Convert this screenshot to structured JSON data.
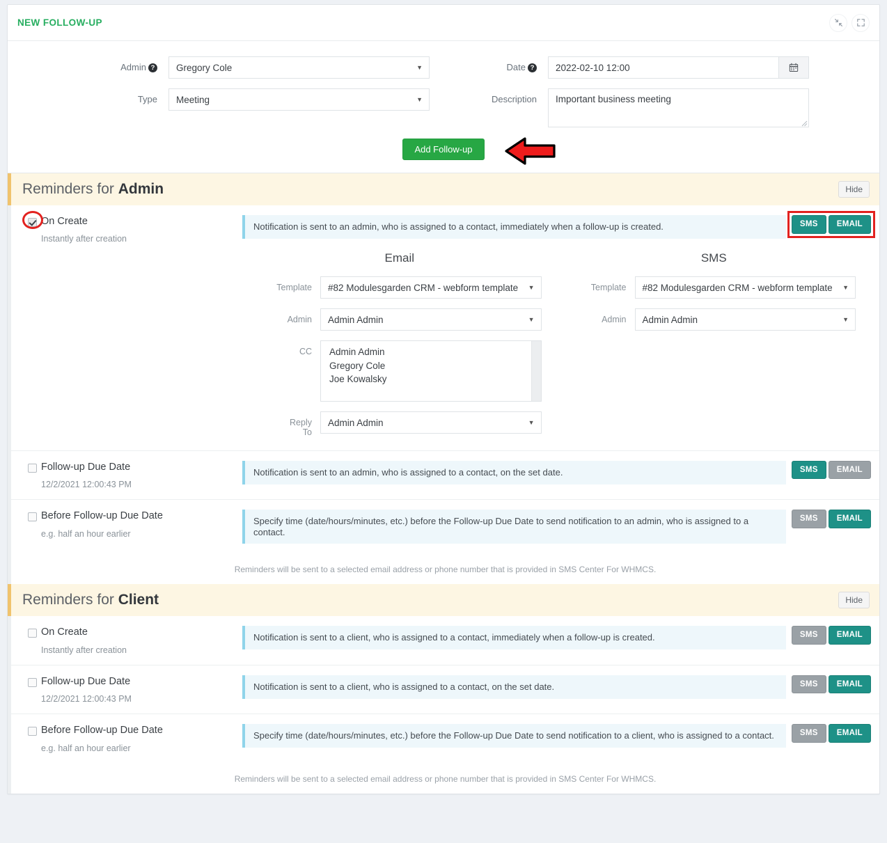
{
  "panel": {
    "title": "NEW FOLLOW-UP",
    "collapse_icon": "collapse-arrows-icon",
    "expand_icon": "expand-arrows-icon"
  },
  "form": {
    "admin_label": "Admin",
    "admin_value": "Gregory Cole",
    "type_label": "Type",
    "type_value": "Meeting",
    "date_label": "Date",
    "date_value": "2022-02-10 12:00",
    "calendar_icon": "calendar-icon",
    "description_label": "Description",
    "description_value": "Important business meeting",
    "submit_label": "Add Follow-up",
    "help_glyph": "?"
  },
  "colors": {
    "accent_green": "#27a744",
    "title_green": "#27ae60",
    "toggle_on": "#1e9187",
    "toggle_off": "#9aa1a6",
    "annotation_red": "#e2221f",
    "section_header_bg": "#fdf6e3",
    "section_header_border": "#f0c36d",
    "notice_bg": "#eef7fb",
    "notice_border": "#8fd4ea"
  },
  "sections": [
    {
      "title_prefix": "Reminders for ",
      "title_strong": "Admin",
      "hide_label": "Hide",
      "footnote": "Reminders will be sent to a selected email address or phone number that is provided in SMS Center For WHMCS.",
      "rows": [
        {
          "name": "On Create",
          "sub": "Instantly after creation",
          "checked": true,
          "notice": "Notification is sent to an admin, who is assigned to a contact, immediately when a follow-up is created.",
          "sms_label": "SMS",
          "email_label": "EMAIL",
          "sms_on": true,
          "email_on": true,
          "highlight_toggles": true,
          "highlight_checkbox": true,
          "expanded": true
        },
        {
          "name": "Follow-up Due Date",
          "sub": "12/2/2021 12:00:43 PM",
          "checked": false,
          "notice": "Notification is sent to an admin, who is assigned to a contact, on the set date.",
          "sms_label": "SMS",
          "email_label": "EMAIL",
          "sms_on": true,
          "email_on": false,
          "highlight_toggles": false,
          "highlight_checkbox": false,
          "expanded": false
        },
        {
          "name": "Before Follow-up Due Date",
          "sub": "e.g. half an hour earlier",
          "checked": false,
          "notice": "Specify time (date/hours/minutes, etc.) before the Follow-up Due Date to send notification to an admin, who is assigned to a contact.",
          "sms_label": "SMS",
          "email_label": "EMAIL",
          "sms_on": false,
          "email_on": true,
          "highlight_toggles": false,
          "highlight_checkbox": false,
          "expanded": false
        }
      ]
    },
    {
      "title_prefix": "Reminders for ",
      "title_strong": "Client",
      "hide_label": "Hide",
      "footnote": "Reminders will be sent to a selected email address or phone number that is provided in SMS Center For WHMCS.",
      "rows": [
        {
          "name": "On Create",
          "sub": "Instantly after creation",
          "checked": false,
          "notice": "Notification is sent to a client, who is assigned to a contact, immediately when a follow-up is created.",
          "sms_label": "SMS",
          "email_label": "EMAIL",
          "sms_on": false,
          "email_on": true,
          "highlight_toggles": false,
          "highlight_checkbox": false,
          "expanded": false
        },
        {
          "name": "Follow-up Due Date",
          "sub": "12/2/2021 12:00:43 PM",
          "checked": false,
          "notice": "Notification is sent to a client, who is assigned to a contact, on the set date.",
          "sms_label": "SMS",
          "email_label": "EMAIL",
          "sms_on": false,
          "email_on": true,
          "highlight_toggles": false,
          "highlight_checkbox": false,
          "expanded": false
        },
        {
          "name": "Before Follow-up Due Date",
          "sub": "e.g. half an hour earlier",
          "checked": false,
          "notice": "Specify time (date/hours/minutes, etc.) before the Follow-up Due Date to send notification to a client, who is assigned to a contact.",
          "sms_label": "SMS",
          "email_label": "EMAIL",
          "sms_on": false,
          "email_on": true,
          "highlight_toggles": false,
          "highlight_checkbox": false,
          "expanded": false
        }
      ]
    }
  ],
  "channels": {
    "email": {
      "heading": "Email",
      "template_label": "Template",
      "template_value": "#82 Modulesgarden CRM - webform template",
      "admin_label": "Admin",
      "admin_value": "Admin Admin",
      "cc_label": "CC",
      "cc_options": [
        "Admin Admin",
        "Gregory Cole",
        "Joe Kowalsky"
      ],
      "reply_to_label_line1": "Reply",
      "reply_to_label_line2": "To",
      "reply_to_value": "Admin Admin"
    },
    "sms": {
      "heading": "SMS",
      "template_label": "Template",
      "template_value": "#82 Modulesgarden CRM - webform template",
      "admin_label": "Admin",
      "admin_value": "Admin Admin"
    }
  }
}
